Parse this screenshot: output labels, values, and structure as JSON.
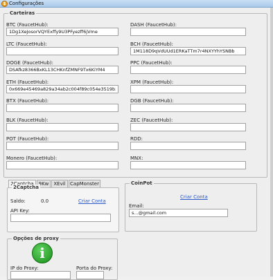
{
  "window": {
    "title": "Configurações"
  },
  "wallets": {
    "title": "Carteiras",
    "fields": [
      {
        "label": "BTC (FaucetHub):",
        "value": "1Dg1XeJosorVQYExffy9U3PFyezff6jVme"
      },
      {
        "label": "DASH (FaucetHub):",
        "value": ""
      },
      {
        "label": "LTC (FaucetHub):",
        "value": ""
      },
      {
        "label": "BCH (FaucetHub):",
        "value": "1M118D9qVdUUd1ERKaTTm7r4NXYYhYSNBb"
      },
      {
        "label": "DOGE (FaucetHub):",
        "value": "DSAfkz8366BxKL13CHKnfZMNF9Tx6KiYM4"
      },
      {
        "label": "PPC (FaucetHub):",
        "value": ""
      },
      {
        "label": "ETH (FaucetHub):",
        "value": "0x669e45469a829a34ab2c004f89c054e3519b3cbd"
      },
      {
        "label": "XPM (FaucetHub):",
        "value": ""
      },
      {
        "label": "BTX (FaucetHub):",
        "value": ""
      },
      {
        "label": "DGB (FaucetHub):",
        "value": ""
      },
      {
        "label": "BLK (FaucetHub):",
        "value": ""
      },
      {
        "label": "ZEC (FaucetHub):",
        "value": ""
      },
      {
        "label": "POT (FaucetHub):",
        "value": ""
      },
      {
        "label": "RDD:",
        "value": ""
      },
      {
        "label": "Monero (FaucetHub):",
        "value": ""
      },
      {
        "label": "MNX:",
        "value": ""
      }
    ]
  },
  "captcha_tabs": [
    "2Captcha",
    "9Kw",
    "XEvil",
    "CapMonster"
  ],
  "twocaptcha": {
    "title": "2Captcha",
    "balance_label": "Saldo:",
    "balance_value": "0.0",
    "create_account": "Criar Conta",
    "api_key_label": "API Key:",
    "api_key_value": ""
  },
  "coinpot": {
    "title": "CoinPot",
    "create_account": "Criar Conta",
    "email_label": "Email:",
    "email_value": "s...@gmail.com"
  },
  "proxy": {
    "title": "Opções de proxy",
    "icon": "info-icon",
    "ip_label": "IP do Proxy:",
    "port_label": "Porta do Proxy:",
    "ip_value": "",
    "port_value": ""
  }
}
